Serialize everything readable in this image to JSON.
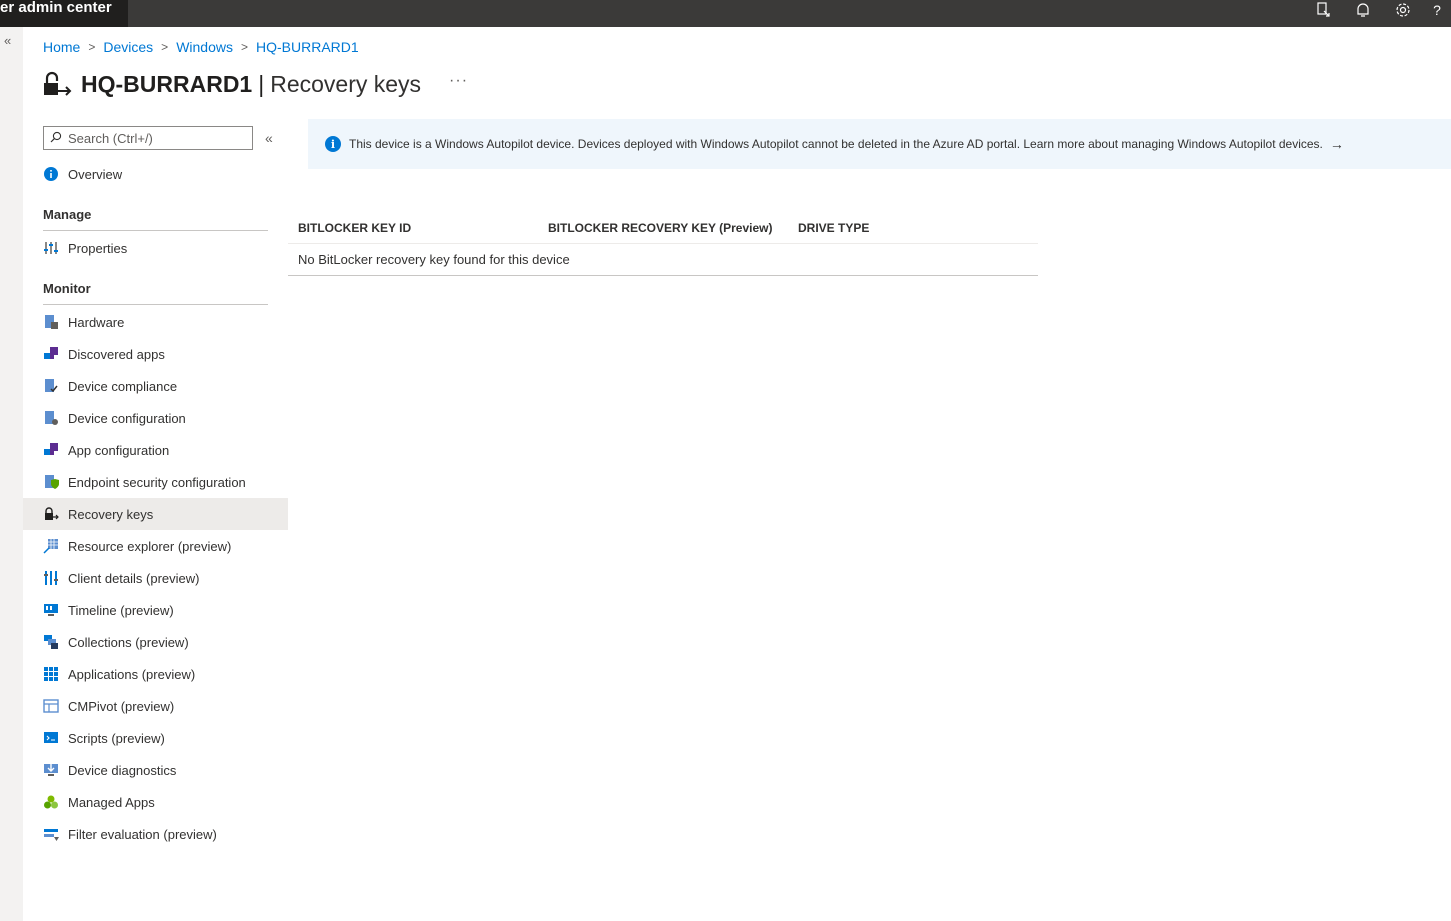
{
  "header": {
    "brand": "er admin center",
    "icons": [
      "feedback-icon",
      "bell-icon",
      "gear-icon",
      "help-icon"
    ]
  },
  "breadcrumb": [
    "Home",
    "Devices",
    "Windows",
    "HQ-BURRARD1"
  ],
  "title": {
    "device": "HQ-BURRARD1",
    "separator": "|",
    "page": "Recovery keys",
    "more": "···"
  },
  "search": {
    "placeholder": "Search (Ctrl+/)"
  },
  "nav": {
    "overview": "Overview",
    "manage_header": "Manage",
    "properties": "Properties",
    "monitor_header": "Monitor",
    "monitor_items": [
      "Hardware",
      "Discovered apps",
      "Device compliance",
      "Device configuration",
      "App configuration",
      "Endpoint security configuration",
      "Recovery keys",
      "Resource explorer (preview)",
      "Client details (preview)",
      "Timeline (preview)",
      "Collections (preview)",
      "Applications (preview)",
      "CMPivot (preview)",
      "Scripts (preview)",
      "Device diagnostics",
      "Managed Apps",
      "Filter evaluation (preview)"
    ],
    "active": "Recovery keys"
  },
  "banner": {
    "text": "This device is a Windows Autopilot device. Devices deployed with Windows Autopilot cannot be deleted in the Azure AD portal. Learn more about managing Windows Autopilot devices.",
    "arrow": "→"
  },
  "table": {
    "columns": [
      "BITLOCKER KEY ID",
      "BITLOCKER RECOVERY KEY (Preview)",
      "DRIVE TYPE"
    ],
    "empty_message": "No BitLocker recovery key found for this device"
  },
  "colors": {
    "accent": "#0078d4",
    "topbar": "#3b3a39",
    "banner_bg": "#eff6fc",
    "active_bg": "#edebe9"
  }
}
